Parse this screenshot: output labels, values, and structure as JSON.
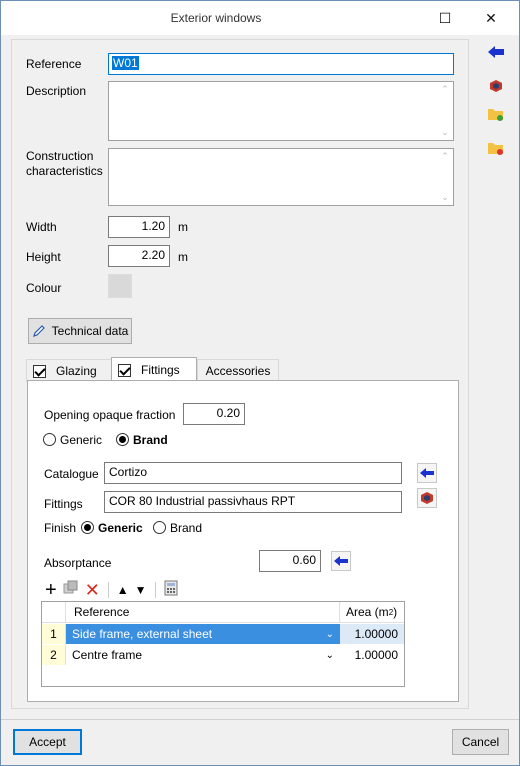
{
  "window": {
    "title": "Exterior windows",
    "maximize_glyph": "☐",
    "close_glyph": "✕"
  },
  "form": {
    "reference_label": "Reference",
    "reference_value": "W01",
    "description_label": "Description",
    "construction_label_line1": "Construction",
    "construction_label_line2": "characteristics",
    "width_label": "Width",
    "width_value": "1.20",
    "width_unit": "m",
    "height_label": "Height",
    "height_value": "2.20",
    "height_unit": "m",
    "colour_label": "Colour",
    "colour_value": "#d9d9d9",
    "technical_data_label": "Technical data"
  },
  "tabs": [
    {
      "label": "Glazing",
      "checked": true
    },
    {
      "label": "Fittings",
      "checked": true,
      "active": true
    },
    {
      "label": "Accessories"
    }
  ],
  "fittings": {
    "opaque_fraction_label": "Opening opaque fraction",
    "opaque_fraction_value": "0.20",
    "type_generic": "Generic",
    "type_brand": "Brand",
    "catalogue_label": "Catalogue",
    "catalogue_value": "Cortizo",
    "fittings_label": "Fittings",
    "fittings_value": "COR 80 Industrial passivhaus RPT",
    "finish_label": "Finish",
    "finish_generic": "Generic",
    "finish_brand": "Brand",
    "absorptance_label": "Absorptance",
    "absorptance_value": "0.60"
  },
  "table": {
    "col_reference": "Reference",
    "col_area": "Area (m",
    "col_area_sup": "2",
    "col_area_close": ")",
    "rows": [
      {
        "index": "1",
        "reference": "Side frame, external sheet",
        "area": "1.00000",
        "selected": true
      },
      {
        "index": "2",
        "reference": "Centre frame",
        "area": "1.00000",
        "selected": false
      }
    ]
  },
  "footer": {
    "accept_label": "Accept",
    "cancel_label": "Cancel"
  },
  "colors": {
    "accent": "#0078d7",
    "arrow_blue": "#1a33cc"
  }
}
